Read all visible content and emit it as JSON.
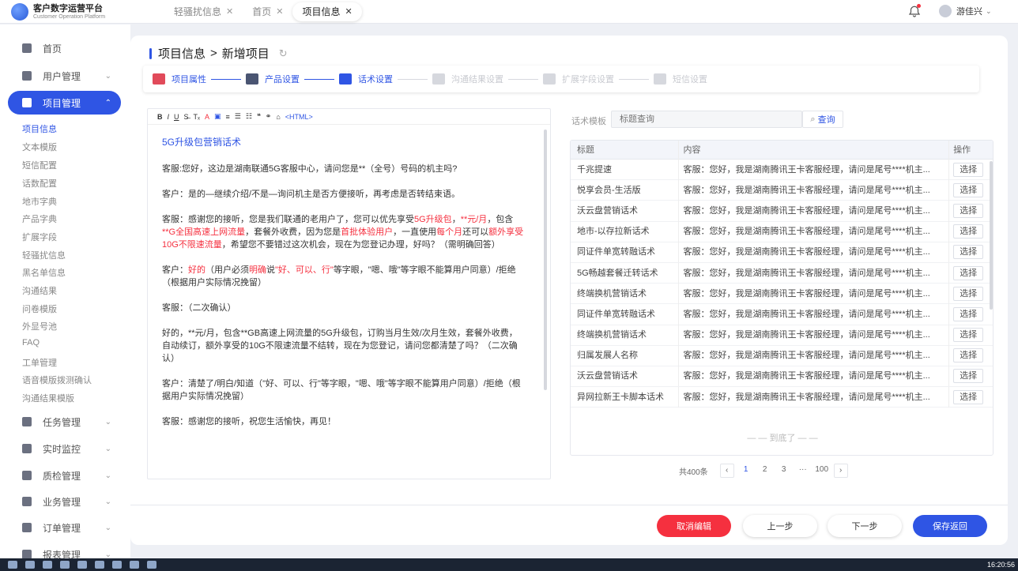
{
  "app": {
    "title": "客户数字运营平台",
    "subtitle": "Customer Operation Platform"
  },
  "tabs": [
    {
      "label": "轻骚扰信息"
    },
    {
      "label": "首页"
    },
    {
      "label": "项目信息"
    }
  ],
  "user": {
    "name": "游佳兴"
  },
  "sidebar": {
    "top_items": [
      {
        "label": "首页",
        "icon": "home-icon"
      },
      {
        "label": "用户管理",
        "icon": "users-icon"
      },
      {
        "label": "项目管理",
        "icon": "project-icon"
      }
    ],
    "sub_items": [
      "项目信息",
      "文本模版",
      "短信配置",
      "话数配置",
      "地市字典",
      "产品字典",
      "扩展字段",
      "轻骚扰信息",
      "黑名单信息",
      "沟通结果",
      "问卷模版",
      "外显号池",
      "FAQ",
      "工单管理",
      "语音模版拨测确认",
      "沟通结果模版"
    ],
    "bottom_items": [
      {
        "label": "任务管理"
      },
      {
        "label": "实时监控"
      },
      {
        "label": "质检管理"
      },
      {
        "label": "业务管理"
      },
      {
        "label": "订单管理"
      },
      {
        "label": "报表管理"
      }
    ]
  },
  "breadcrumb": {
    "parent": "项目信息",
    "sep": ">",
    "current": "新增项目"
  },
  "steps": [
    {
      "label": "项目属性",
      "state": "done"
    },
    {
      "label": "产品设置",
      "state": "done"
    },
    {
      "label": "话术设置",
      "state": "active"
    },
    {
      "label": "沟通结果设置",
      "state": "todo"
    },
    {
      "label": "扩展字段设置",
      "state": "todo"
    },
    {
      "label": "短信设置",
      "state": "todo"
    }
  ],
  "editor": {
    "toolbar": [
      "B",
      "I",
      "U",
      "S̶",
      "Tₓ",
      "A",
      "▣",
      "≡",
      "☰",
      "☷",
      "❝",
      "⚭",
      "⌂",
      "<HTML>"
    ],
    "title": "5G升级包营销话术",
    "p1": "客服:您好，这边是湖南联通5G客服中心，请问您是**（全号）号码的机主吗?",
    "p2": "客户：是的—继续介绍/不是—询问机主是否方便接听，再考虑是否转结束语。",
    "p3a": "客服：感谢您的接听，您是我们联通的老用户了，您可以优先享受",
    "p3r1": "5G升级包",
    "p3b": "，",
    "p3r2": "**元/月",
    "p3c": "，包含",
    "p3r3": "**G全国高速上网流量",
    "p3d": "，套餐外收费，因为您是",
    "p3r4": "首批体验用户",
    "p3e": "，一直使用",
    "p3r5": "每个月",
    "p3f": "还可以",
    "p3r6": "额外享受10G不限速流量",
    "p3g": "，希望您不要错过这次机会，现在为您登记办理，好吗？（需明确回答）",
    "p4a": "客户：",
    "p4r1": "好的",
    "p4b": "（用户必须",
    "p4r2": "明确",
    "p4c": "说",
    "p4r3": "\"好、可以、行\"",
    "p4d": "等字眼，\"嗯、哦\"等字眼不能算用户同意）/拒绝（根据用户实际情况挽留）",
    "p5": "客服：（二次确认）",
    "p6": "好的，**元/月，包含**GB高速上网流量的5G升级包，订购当月生效/次月生效，套餐外收费，自动续订，额外享受的10G不限速流量不结转，现在为您登记，请问您都清楚了吗？（二次确认）",
    "p7": "客户：清楚了/明白/知道（\"好、可以、行\"等字眼，\"嗯、哦\"等字眼不能算用户同意）/拒绝（根据用户实际情况挽留）",
    "p8": "客服：感谢您的接听，祝您生活愉快，再见！"
  },
  "template": {
    "label": "话术模板",
    "placeholder": "标题查询",
    "search_btn": "查询",
    "headers": [
      "标题",
      "内容",
      "操作"
    ],
    "rows": [
      {
        "title": "千兆提速",
        "content": "客服：您好，我是湖南腾讯王卡客服经理，请问是尾号****机主...",
        "action": "选择"
      },
      {
        "title": "悦享会员-生活版",
        "content": "客服：您好，我是湖南腾讯王卡客服经理，请问是尾号****机主...",
        "action": "选择"
      },
      {
        "title": "沃云盘营销话术",
        "content": "客服：您好，我是湖南腾讯王卡客服经理，请问是尾号****机主...",
        "action": "选择"
      },
      {
        "title": "地市-以存拉新话术",
        "content": "客服：您好，我是湖南腾讯王卡客服经理，请问是尾号****机主...",
        "action": "选择"
      },
      {
        "title": "同证件单宽转融话术",
        "content": "客服：您好，我是湖南腾讯王卡客服经理，请问是尾号****机主...",
        "action": "选择"
      },
      {
        "title": "5G畅越套餐迁转话术",
        "content": "客服：您好，我是湖南腾讯王卡客服经理，请问是尾号****机主...",
        "action": "选择"
      },
      {
        "title": "终端换机营销话术",
        "content": "客服：您好，我是湖南腾讯王卡客服经理，请问是尾号****机主...",
        "action": "选择"
      },
      {
        "title": "同证件单宽转融话术",
        "content": "客服：您好，我是湖南腾讯王卡客服经理，请问是尾号****机主...",
        "action": "选择"
      },
      {
        "title": "终端换机营销话术",
        "content": "客服：您好，我是湖南腾讯王卡客服经理，请问是尾号****机主...",
        "action": "选择"
      },
      {
        "title": "归属发展人名称",
        "content": "客服：您好，我是湖南腾讯王卡客服经理，请问是尾号****机主...",
        "action": "选择"
      },
      {
        "title": "沃云盘营销话术",
        "content": "客服：您好，我是湖南腾讯王卡客服经理，请问是尾号****机主...",
        "action": "选择"
      },
      {
        "title": "异网拉新王卡脚本话术",
        "content": "客服：您好，我是湖南腾讯王卡客服经理，请问是尾号****机主...",
        "action": "选择"
      }
    ],
    "end_text": "— — 到底了 — —"
  },
  "pager": {
    "total": "共400条",
    "pages": [
      "1",
      "2",
      "3",
      "···",
      "100"
    ]
  },
  "footer": {
    "cancel": "取消编辑",
    "prev": "上一步",
    "next": "下一步",
    "save": "保存返回"
  },
  "taskbar": {
    "time": "16:20:56"
  },
  "colors": {
    "primary": "#2f55e4",
    "danger": "#f5303f"
  }
}
